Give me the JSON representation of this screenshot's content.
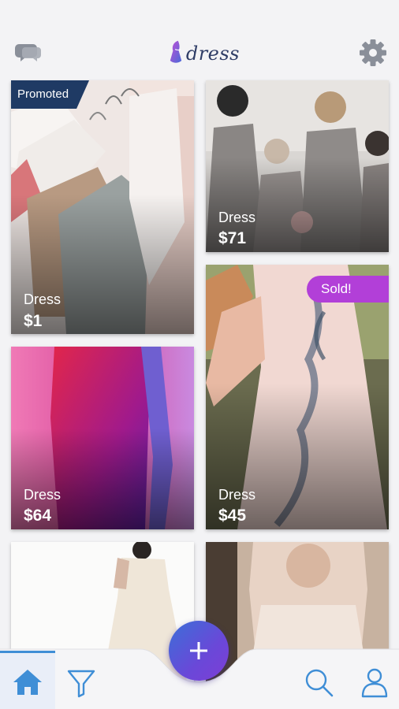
{
  "app": {
    "logo_text": "dress",
    "brand_colors": {
      "navy": "#2f3d66",
      "purple": "#b23fd8",
      "blue": "#3f8ed6"
    }
  },
  "header": {
    "left_icon": "chat-bubbles-icon",
    "right_icon": "gear-icon"
  },
  "listings": [
    {
      "name": "Dress",
      "price": "$1",
      "badge": "Promoted"
    },
    {
      "name": "Dress",
      "price": "$71",
      "badge": ""
    },
    {
      "name": "Dress",
      "price": "$64",
      "badge": ""
    },
    {
      "name": "Dress",
      "price": "$45",
      "badge": "Sold!"
    },
    {
      "name": "",
      "price": "",
      "badge": ""
    },
    {
      "name": "",
      "price": "",
      "badge": ""
    }
  ],
  "bottom_nav": {
    "items": [
      {
        "icon": "home-icon",
        "active": true
      },
      {
        "icon": "filter-icon",
        "active": false
      },
      {
        "icon": "plus-icon",
        "active": false
      },
      {
        "icon": "search-icon",
        "active": false
      },
      {
        "icon": "user-icon",
        "active": false
      }
    ],
    "fab_label": "+"
  }
}
